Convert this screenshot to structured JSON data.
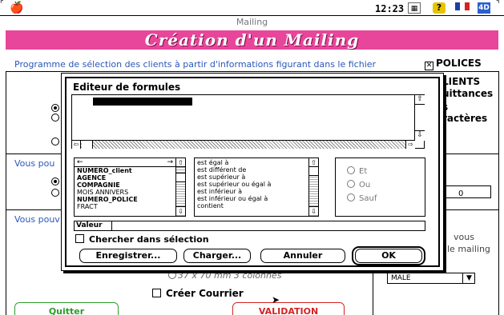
{
  "menubar": {
    "clock": "12:23",
    "icons": [
      "apple-icon",
      "app-switcher-icon",
      "help-icon",
      "french-flag-icon",
      "4d-icon"
    ],
    "icon_4d_label": "4D",
    "help_label": "?"
  },
  "window": {
    "title": "Mailing"
  },
  "banner": {
    "title": "Création d'un Mailing",
    "color": "#e8469a"
  },
  "form": {
    "program_text": "Programme de sélection des clients à partir d'informations figurant dans le fichier",
    "polices_label": "POLICES",
    "polices_checked": true,
    "right_frag_1": "LIENTS",
    "right_frag_2": "uittances",
    "right_frag_3": "s",
    "right_frag_4": "ractères",
    "vous_1": "Vous pou",
    "vous_2": "Vous pouv",
    "vous_right": "vous",
    "mailing_right": "le mailing",
    "zero_value": "0",
    "label_size": "37 x 70 mm 3 colonnes",
    "creer_courrier": "Créer Courrier",
    "creer_checked": false,
    "gender_select": "MALE",
    "quitter": "Quitter",
    "validation": "VALIDATION"
  },
  "dialog": {
    "title": "Editeur de formules",
    "fields_header_left": "←",
    "fields_header_right": "→",
    "fields": [
      {
        "label": "NUMERO_client",
        "bold": true
      },
      {
        "label": "AGENCE",
        "bold": true
      },
      {
        "label": "COMPAGNIE",
        "bold": true
      },
      {
        "label": "MOIS ANNIVERS",
        "bold": false
      },
      {
        "label": "NUMERO_POLICE",
        "bold": true
      },
      {
        "label": "FRACT",
        "bold": false
      }
    ],
    "operators": [
      "est égal à",
      "est différent de",
      "est supérieur à",
      "est supérieur ou égal à",
      "est inférieur à",
      "est inférieur ou égal à",
      "contient"
    ],
    "logic": [
      "Et",
      "Ou",
      "Sauf"
    ],
    "valeur_label": "Valeur",
    "valeur_value": "",
    "search_in_selection": "Chercher dans sélection",
    "search_in_selection_checked": false,
    "buttons": {
      "save": "Enregistrer...",
      "load": "Charger...",
      "cancel": "Annuler",
      "ok": "OK"
    }
  },
  "colors": {
    "quitter": "#2c9c2c",
    "validation": "#d42323",
    "form_text": "#2a58b8"
  }
}
